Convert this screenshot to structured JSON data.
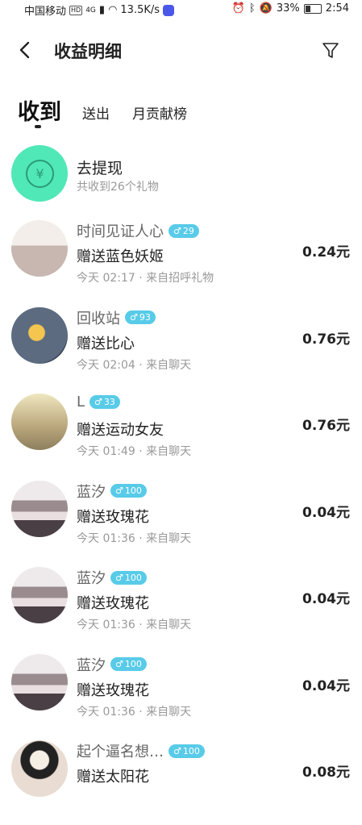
{
  "status_bar": {
    "carrier": "中国移动",
    "hd": "HD",
    "net": "4G",
    "speed": "13.5K/s",
    "battery": "33%",
    "time": "2:54"
  },
  "header": {
    "title": "收益明细"
  },
  "tabs": {
    "received": "收到",
    "sent": "送出",
    "monthly": "月贡献榜"
  },
  "withdraw": {
    "icon_symbol": "¥",
    "title": "去提现",
    "subtitle": "共收到26个礼物"
  },
  "records": [
    {
      "name": "时间见证人心",
      "gender": "♂",
      "level": "29",
      "gift": "赠送蓝色妖姬",
      "meta": "今天 02:17 · 来自招呼礼物",
      "amount": "0.24元"
    },
    {
      "name": "回收站",
      "gender": "♂",
      "level": "93",
      "gift": "赠送比心",
      "meta": "今天 02:04 · 来自聊天",
      "amount": "0.76元"
    },
    {
      "name": "L",
      "gender": "♂",
      "level": "33",
      "gift": "赠送运动女友",
      "meta": "今天 01:49 · 来自聊天",
      "amount": "0.76元"
    },
    {
      "name": "蓝汐",
      "gender": "♂",
      "level": "100",
      "gift": "赠送玫瑰花",
      "meta": "今天 01:36 · 来自聊天",
      "amount": "0.04元"
    },
    {
      "name": "蓝汐",
      "gender": "♂",
      "level": "100",
      "gift": "赠送玫瑰花",
      "meta": "今天 01:36 · 来自聊天",
      "amount": "0.04元"
    },
    {
      "name": "蓝汐",
      "gender": "♂",
      "level": "100",
      "gift": "赠送玫瑰花",
      "meta": "今天 01:36 · 来自聊天",
      "amount": "0.04元"
    },
    {
      "name": "起个逼名想…",
      "gender": "♂",
      "level": "100",
      "gift": "赠送太阳花",
      "meta": "",
      "amount": "0.08元"
    }
  ]
}
